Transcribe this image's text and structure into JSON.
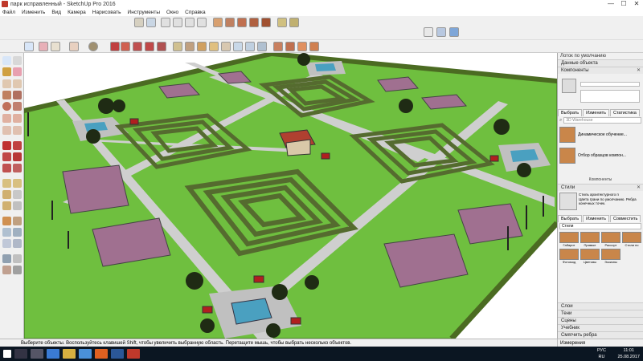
{
  "window": {
    "title": "парк исправленный - SketchUp Pro 2016",
    "minimize_icon": "—",
    "maximize_icon": "☐",
    "close_icon": "✕"
  },
  "menubar": {
    "items": [
      "Файл",
      "Изменить",
      "Вид",
      "Камера",
      "Нарисовать",
      "Инструменты",
      "Окно",
      "Справка"
    ]
  },
  "right_panel": {
    "header": "Лоток по умолчанию",
    "entity_info": "Данные объекта",
    "components": "Компоненты",
    "comp_tabs": [
      "Выбрать",
      "Изменить",
      "Статистика"
    ],
    "search_placeholder": "3D Warehouse",
    "comp_items": [
      "Динамическое обучение...",
      "Отбор образцов компон..."
    ],
    "comp_footer": "Компоненты",
    "styles": "Стили",
    "style_name": "Стиль архитектурного п",
    "style_desc": "Цвета грани по умолчанию. Ребра конечных точек.",
    "style_tabs": [
      "Выбрать",
      "Изменить",
      "Совместить"
    ],
    "style_dropdown": "Стили",
    "style_swatches": [
      "Габарит",
      "Прямые",
      "Рассорт",
      "Стили по",
      "Фотомод",
      "Цветовы",
      "Эскизны",
      ""
    ],
    "bottom_sections": [
      "Слои",
      "Тени",
      "Сцены",
      "Учебник",
      "Смягчить ребра"
    ]
  },
  "status": {
    "message": "Выберите объекты. Воспользуйтесь клавишей Shift, чтобы увеличить выбранную область. Перетащите мышь, чтобы выбрать несколько объектов.",
    "measure_label": "Измерения"
  },
  "taskbar": {
    "lang_top": "РУС",
    "lang_bottom": "RU",
    "time": "11:01",
    "date": "25.08.2017"
  },
  "colors": {
    "grass": "#6fbf3f",
    "hedge": "#556b2f",
    "path": "#c8c8c8",
    "flowerbed": "#a07090",
    "water": "#4aa0c0"
  }
}
